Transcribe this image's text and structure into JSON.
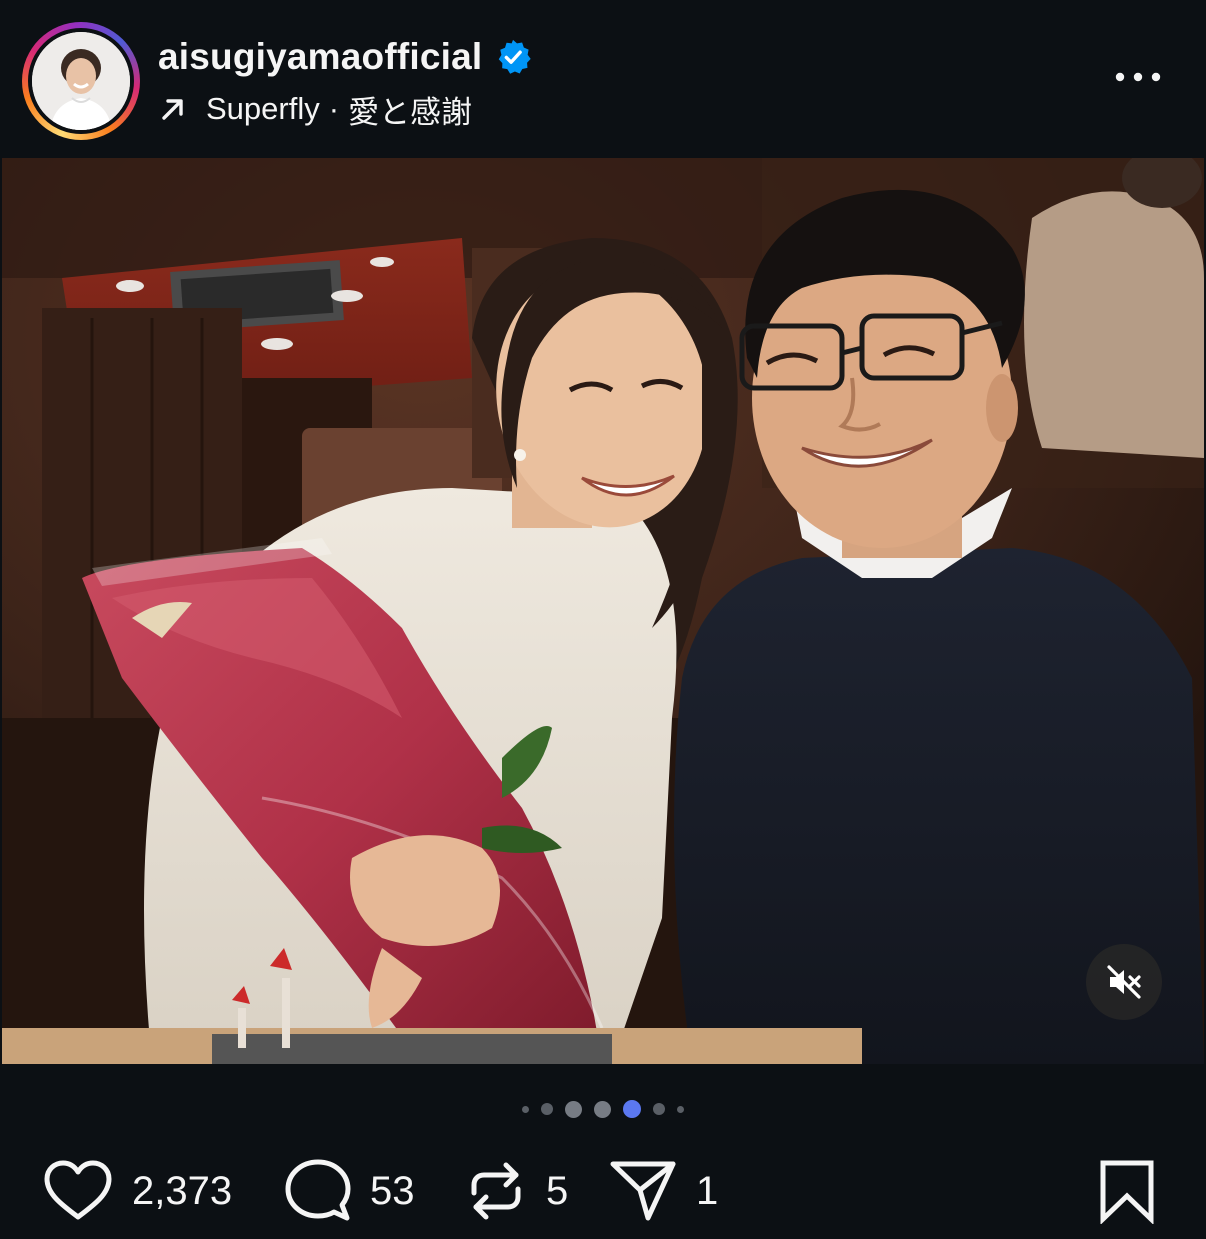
{
  "post": {
    "username": "aisugiyamaofficial",
    "verified": true,
    "music": {
      "artist": "Superfly",
      "separator": "·",
      "title": "愛と感謝"
    }
  },
  "carousel": {
    "total": 7,
    "current": 5
  },
  "actions": {
    "likes": "2,373",
    "comments": "53",
    "reposts": "5",
    "shares": "1"
  },
  "icons": {
    "verified": "verified-badge-icon",
    "music": "arrow-up-right-icon",
    "more": "more-horizontal-icon",
    "mute": "speaker-muted-icon",
    "like": "heart-icon",
    "comment": "speech-bubble-icon",
    "repost": "repost-icon",
    "share": "paper-plane-icon",
    "save": "bookmark-icon"
  },
  "colors": {
    "background": "#0c1014",
    "verified": "#0095f6",
    "dot_active": "#5b78f0"
  }
}
